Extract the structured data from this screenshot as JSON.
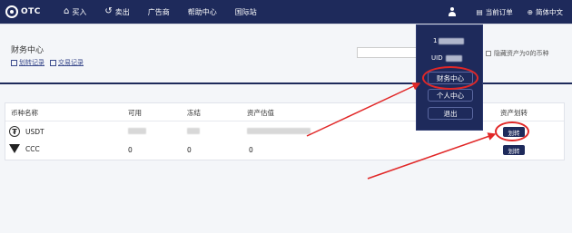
{
  "header": {
    "logo_text": "OTC",
    "nav": [
      {
        "label": "买入",
        "icon": "home-icon"
      },
      {
        "label": "卖出",
        "icon": "refresh-icon"
      },
      {
        "label": "广告商"
      },
      {
        "label": "帮助中心"
      },
      {
        "label": "国际站"
      }
    ],
    "orders_label": "当前订单",
    "lang_label": "简体中文"
  },
  "page": {
    "title": "财务中心",
    "links": [
      "划转记录",
      "交易记录"
    ],
    "hide_zero_label": "隐藏资产为0的币种"
  },
  "table": {
    "headers": [
      "币种名称",
      "可用",
      "冻结",
      "资产估值",
      "资产划转"
    ],
    "rows": [
      {
        "coin": "USDT",
        "available": "",
        "frozen": "",
        "valuation": "",
        "action": "划转"
      },
      {
        "coin": "CCC",
        "available": "0",
        "frozen": "0",
        "valuation": "0",
        "action": "划转"
      }
    ]
  },
  "dropdown": {
    "account": "1",
    "uid_label": "UID",
    "items": [
      "财务中心",
      "个人中心",
      "退出"
    ]
  },
  "colors": {
    "primary": "#1e2a5b",
    "highlight": "#e12727"
  }
}
